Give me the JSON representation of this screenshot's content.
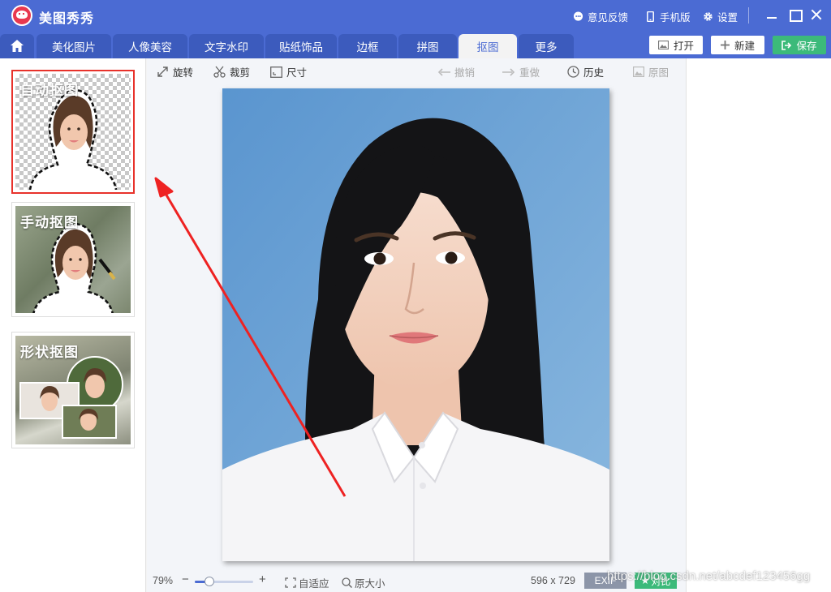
{
  "app": {
    "title": "美图秀秀"
  },
  "titlebar": {
    "feedback": "意见反馈",
    "mobile": "手机版",
    "settings": "设置"
  },
  "tabs": [
    {
      "label": "美化图片"
    },
    {
      "label": "人像美容"
    },
    {
      "label": "文字水印"
    },
    {
      "label": "贴纸饰品"
    },
    {
      "label": "边框"
    },
    {
      "label": "拼图"
    },
    {
      "label": "抠图",
      "active": true
    },
    {
      "label": "更多"
    }
  ],
  "actions": {
    "open": "打开",
    "new": "新建",
    "save": "保存"
  },
  "cutout_modes": [
    {
      "label": "自动抠图",
      "selected": true
    },
    {
      "label": "手动抠图",
      "selected": false
    },
    {
      "label": "形状抠图",
      "selected": false
    }
  ],
  "toolbar": {
    "rotate": "旋转",
    "crop": "裁剪",
    "size": "尺寸",
    "undo": "撤销",
    "redo": "重做",
    "history": "历史",
    "original": "原图"
  },
  "statusbar": {
    "zoom": "79%",
    "zoom_level": 0.25,
    "fit": "自适应",
    "actual_size": "原大小",
    "dimensions": "596 x 729",
    "exif": "EXIF",
    "compare": "对比"
  },
  "watermark": "https://blog.csdn.net/abcdef123456gg",
  "colors": {
    "titlebar": "#4b6bd3",
    "tab_active_text": "#4b6bd3",
    "save_green": "#3cba7a",
    "selection_red": "#e8322b"
  }
}
